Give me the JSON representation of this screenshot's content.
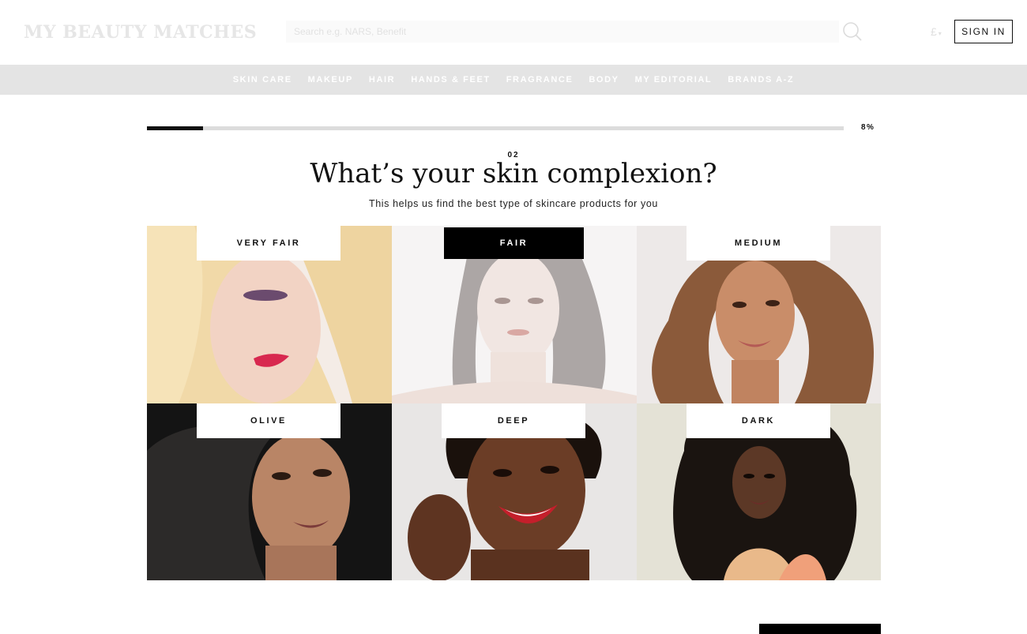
{
  "header": {
    "logo": "MY BEAUTY MATCHES",
    "search_placeholder": "Search e.g. NARS, Benefit",
    "currency": "£",
    "sign_in": "SIGN IN"
  },
  "nav": {
    "items": [
      "SKIN CARE",
      "MAKEUP",
      "HAIR",
      "HANDS & FEET",
      "FRAGRANCE",
      "BODY",
      "MY EDITORIAL",
      "BRANDS A-Z"
    ]
  },
  "progress": {
    "value": 0.08,
    "label": "8%"
  },
  "question": {
    "number": "02",
    "title": "What’s your skin complexion?",
    "subtitle": "This helps us find the best type of skincare products for you"
  },
  "options": [
    {
      "label": "VERY FAIR",
      "selected": false,
      "tone": "#f3dccd"
    },
    {
      "label": "FAIR",
      "selected": true,
      "tone": "#efe2dc"
    },
    {
      "label": "MEDIUM",
      "selected": false,
      "tone": "#c98d69"
    },
    {
      "label": "OLIVE",
      "selected": false,
      "tone": "#b98566"
    },
    {
      "label": "DEEP",
      "selected": false,
      "tone": "#6b3d26"
    },
    {
      "label": "DARK",
      "selected": false,
      "tone": "#5c3826"
    }
  ],
  "colors": {
    "accent": "#000000",
    "nav_bg": "#e4e4e4",
    "progress_track": "#dcdcdc"
  }
}
